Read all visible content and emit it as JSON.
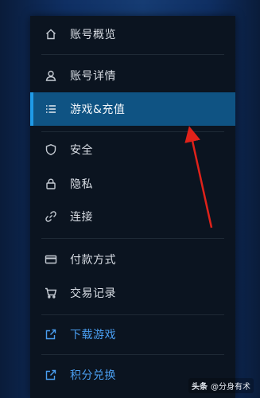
{
  "menu": {
    "items": [
      {
        "label": "账号概览",
        "icon": "home-icon"
      },
      {
        "label": "账号详情",
        "icon": "user-icon"
      },
      {
        "label": "游戏&充值",
        "icon": "list-icon"
      },
      {
        "label": "安全",
        "icon": "shield-icon"
      },
      {
        "label": "隐私",
        "icon": "lock-icon"
      },
      {
        "label": "连接",
        "icon": "link-icon"
      },
      {
        "label": "付款方式",
        "icon": "credit-card-icon"
      },
      {
        "label": "交易记录",
        "icon": "cart-icon"
      },
      {
        "label": "下载游戏",
        "icon": "external-link-icon"
      },
      {
        "label": "积分兑换",
        "icon": "external-link-icon"
      }
    ],
    "active_index": 2
  },
  "colors": {
    "panel_bg": "#0b1420",
    "active_bg": "#0f5383",
    "active_accent": "#1f9be8",
    "link": "#4a9ef0",
    "annotation_arrow": "#e0221a"
  },
  "watermark": {
    "brand": "头条",
    "account": "@分身有术"
  }
}
